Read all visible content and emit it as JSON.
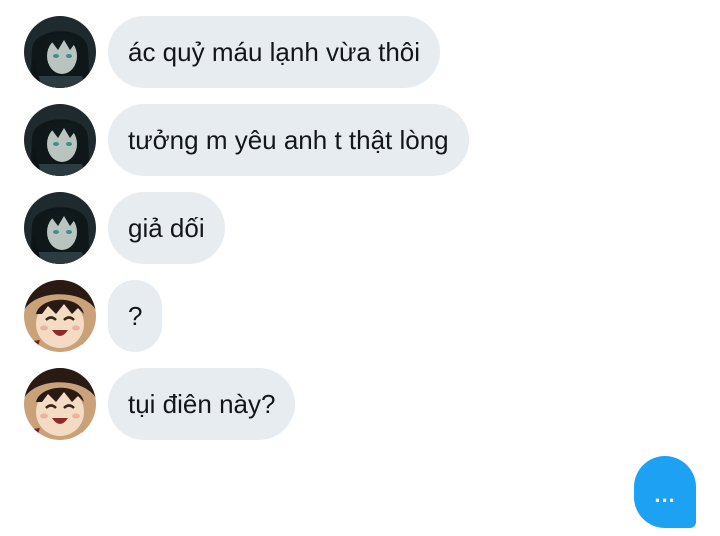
{
  "conversation": {
    "messages": [
      {
        "sender_avatar": "dark-haired-character-avatar",
        "text": "ác quỷ máu lạnh vừa thôi"
      },
      {
        "sender_avatar": "dark-haired-character-avatar",
        "text": "tưởng m yêu anh t thật lòng"
      },
      {
        "sender_avatar": "dark-haired-character-avatar",
        "text": "giả dối"
      },
      {
        "sender_avatar": "smiling-character-avatar",
        "text": "?"
      },
      {
        "sender_avatar": "smiling-character-avatar",
        "text": "tụi điên này?"
      }
    ],
    "typing_indicator": {
      "text": "...",
      "color": "#1da1f2"
    }
  },
  "colors": {
    "bubble_background": "#e6ecf0",
    "bubble_text": "#14171a",
    "page_background": "#ffffff"
  }
}
